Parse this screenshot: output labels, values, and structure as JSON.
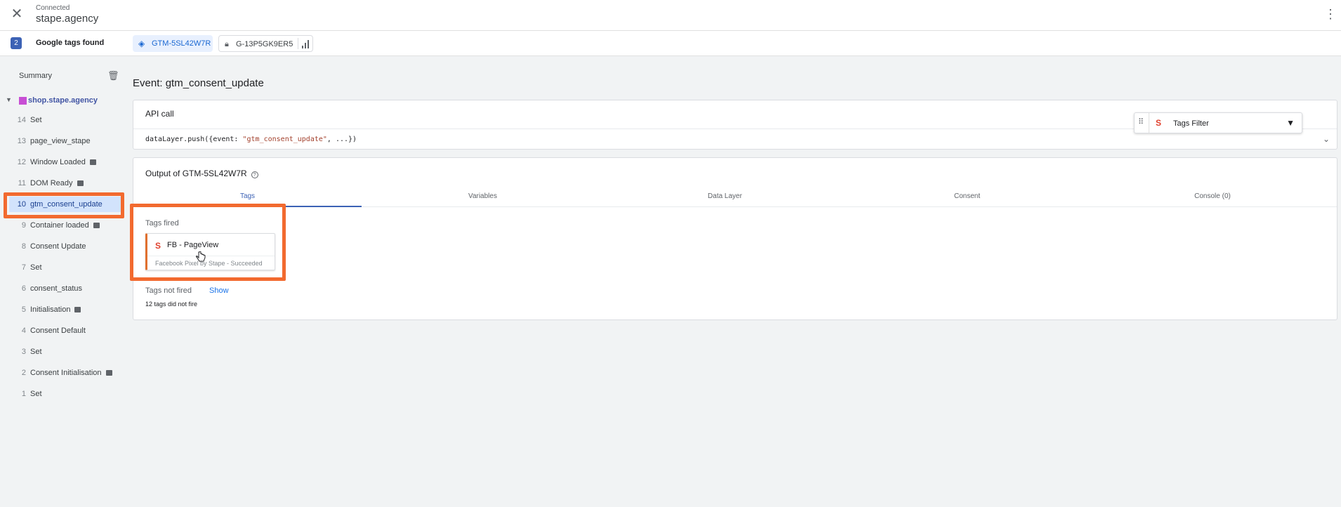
{
  "header": {
    "close_icon": "close-icon",
    "status": "Connected",
    "site": "stape.agency",
    "more_icon": "more-vert-icon"
  },
  "tagbar": {
    "count": "2",
    "label": "Google tags found",
    "containers": [
      {
        "id": "GTM-5SL42W7R",
        "icon": "gtm-diamond-icon",
        "active": true
      },
      {
        "id": "G-13P5GK9ER5",
        "icon": "lock-icon",
        "active": false
      }
    ],
    "analytics_icon": "bar-chart-icon"
  },
  "sidebar": {
    "summary": "Summary",
    "clear_icon": "clear-list-icon",
    "page": "shop.stape.agency",
    "events": [
      {
        "num": "14",
        "name": "Set",
        "icon": false
      },
      {
        "num": "13",
        "name": "page_view_stape",
        "icon": false
      },
      {
        "num": "12",
        "name": "Window Loaded",
        "icon": true
      },
      {
        "num": "11",
        "name": "DOM Ready",
        "icon": true
      },
      {
        "num": "10",
        "name": "gtm_consent_update",
        "icon": false,
        "selected": true
      },
      {
        "num": "9",
        "name": "Container loaded",
        "icon": true
      },
      {
        "num": "8",
        "name": "Consent Update",
        "icon": false
      },
      {
        "num": "7",
        "name": "Set",
        "icon": false
      },
      {
        "num": "6",
        "name": "consent_status",
        "icon": false
      },
      {
        "num": "5",
        "name": "Initialisation",
        "icon": true
      },
      {
        "num": "4",
        "name": "Consent Default",
        "icon": false
      },
      {
        "num": "3",
        "name": "Set",
        "icon": false
      },
      {
        "num": "2",
        "name": "Consent Initialisation",
        "icon": true
      },
      {
        "num": "1",
        "name": "Set",
        "icon": false
      }
    ]
  },
  "main": {
    "event_title": "Event: gtm_consent_update",
    "api": {
      "title": "API call",
      "code_prefix": "dataLayer.push({event: ",
      "code_string": "\"gtm_consent_update\"",
      "code_suffix": ", ...})"
    },
    "filter": {
      "label": "Tags Filter",
      "logo": "S"
    },
    "output": {
      "title": "Output of GTM-5SL42W7R",
      "tabs": [
        "Tags",
        "Variables",
        "Data Layer",
        "Consent",
        "Console (0)"
      ],
      "active_tab": "Tags",
      "fired_label": "Tags fired",
      "fired_tags": [
        {
          "name": "FB - PageView",
          "status": "Facebook Pixel by Stape - Succeeded",
          "logo": "S"
        }
      ],
      "not_fired_label": "Tags not fired",
      "show_label": "Show",
      "not_fired_count": "12 tags did not fire"
    }
  },
  "colors": {
    "accent": "#3c62b5",
    "highlight": "#f26a2f",
    "selected_bg": "#d2e3fc",
    "page_square": "#c74ed4"
  }
}
